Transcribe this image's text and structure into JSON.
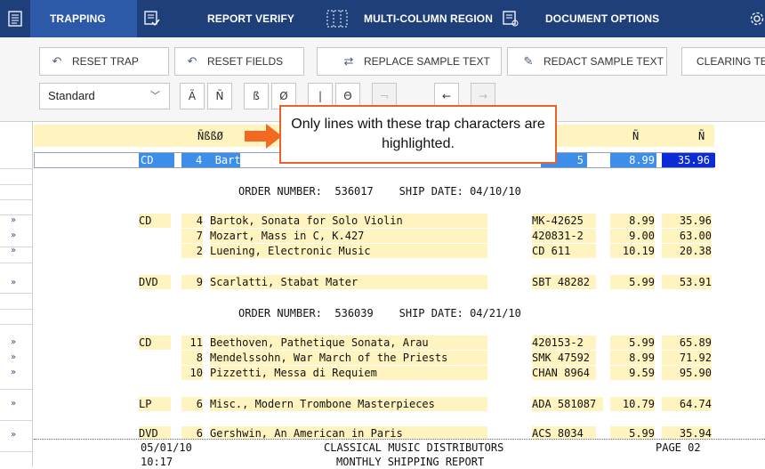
{
  "topbar": {
    "tabs": [
      {
        "label": "TRAPPING",
        "icon": "document-list-icon"
      },
      {
        "label": "REPORT VERIFY",
        "icon": "verify-list-icon"
      },
      {
        "label": "MULTI-COLUMN REGION",
        "icon": "columns-icon"
      },
      {
        "label": "DOCUMENT OPTIONS",
        "icon": "document-options-icon"
      }
    ],
    "settings_icon": "gear-icon",
    "colors": {
      "bar": "#1f3f7a",
      "active": "#2c5aa8"
    }
  },
  "toolbar": {
    "buttons": [
      {
        "label": "RESET TRAP",
        "icon": "reset-trap-icon"
      },
      {
        "label": "RESET FIELDS",
        "icon": "reset-fields-icon"
      },
      {
        "label": "REPLACE SAMPLE TEXT",
        "icon": "replace-icon"
      },
      {
        "label": "REDACT SAMPLE TEXT",
        "icon": "redact-icon"
      },
      {
        "label": "CLEARING TEM",
        "icon": ""
      }
    ],
    "select": {
      "value": "Standard"
    },
    "char_buttons": [
      "Ã",
      "Ñ",
      "ß",
      "Ø",
      "|",
      "Θ",
      "¬",
      "←",
      "→"
    ]
  },
  "callout": {
    "text": "Only lines with these trap characters are highlighted.",
    "border_color": "#e8622a"
  },
  "report": {
    "header_row": {
      "trap_chars": "ÑßßØ",
      "col_n1": "Ñ",
      "col_n2": "Ñ"
    },
    "selected_row": {
      "type": "CD",
      "qty": "4",
      "title": "Bartok, S",
      "cat_tail": "5",
      "price": "8.99",
      "total": "35.96"
    },
    "orders": [
      {
        "order_line": "ORDER NUMBER:  536017    SHIP DATE: 04/10/10",
        "groups": [
          {
            "type": "CD",
            "items": [
              {
                "qty": "4",
                "title": "Bartok, Sonata for Solo Violin",
                "cat": "MK-42625",
                "price": "8.99",
                "total": "35.96"
              },
              {
                "qty": "7",
                "title": "Mozart, Mass in C, K.427",
                "cat": "420831-2",
                "price": "9.00",
                "total": "63.00"
              },
              {
                "qty": "2",
                "title": "Luening, Electronic Music",
                "cat": "CD 611",
                "price": "10.19",
                "total": "20.38"
              }
            ]
          },
          {
            "type": "DVD",
            "items": [
              {
                "qty": "9",
                "title": "Scarlatti, Stabat Mater",
                "cat": "SBT 48282",
                "price": "5.99",
                "total": "53.91"
              }
            ]
          }
        ]
      },
      {
        "order_line": "ORDER NUMBER:  536039    SHIP DATE: 04/21/10",
        "groups": [
          {
            "type": "CD",
            "items": [
              {
                "qty": "11",
                "title": "Beethoven, Pathetique Sonata, Arau",
                "cat": "420153-2",
                "price": "5.99",
                "total": "65.89"
              },
              {
                "qty": "8",
                "title": "Mendelssohn, War March of the Priests",
                "cat": "SMK 47592",
                "price": "8.99",
                "total": "71.92"
              },
              {
                "qty": "10",
                "title": "Pizzetti, Messa di Requiem",
                "cat": "CHAN 8964",
                "price": "9.59",
                "total": "95.90"
              }
            ]
          },
          {
            "type": "LP",
            "items": [
              {
                "qty": "6",
                "title": "Misc., Modern Trombone Masterpieces",
                "cat": "ADA 581087",
                "price": "10.79",
                "total": "64.74"
              }
            ]
          },
          {
            "type": "DVD",
            "items": [
              {
                "qty": "6",
                "title": "Gershwin, An American in Paris",
                "cat": "ACS 8034",
                "price": "5.99",
                "total": "35.94"
              }
            ]
          }
        ]
      }
    ],
    "footer": {
      "date": "05/01/10",
      "time": "10:17",
      "company": "CLASSICAL MUSIC DISTRIBUTORS",
      "report_name": "MONTHLY SHIPPING REPORT",
      "page": "PAGE 02"
    },
    "gutter_marker": "»",
    "highlight_color": "#fff4c0"
  }
}
